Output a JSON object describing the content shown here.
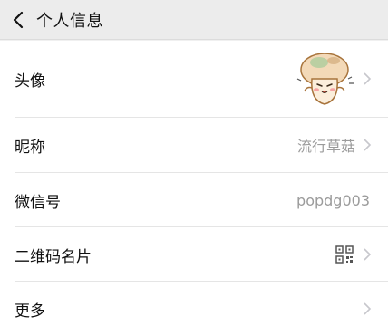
{
  "header": {
    "title": "个人信息"
  },
  "rows": {
    "avatar": {
      "label": "头像"
    },
    "nickname": {
      "label": "昵称",
      "value": "流行草菇"
    },
    "wechat_id": {
      "label": "微信号",
      "value": "popdg003"
    },
    "qrcode": {
      "label": "二维码名片"
    },
    "more": {
      "label": "更多"
    }
  }
}
